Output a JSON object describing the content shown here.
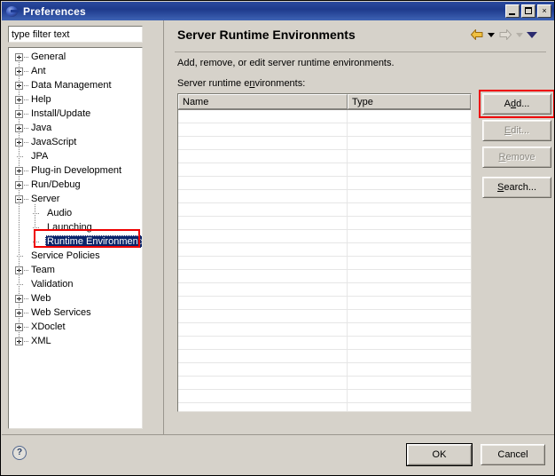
{
  "window": {
    "title": "Preferences",
    "icon": "eclipse-sphere-icon",
    "controls": {
      "minimize": "minimize-icon",
      "maximize": "maximize-icon",
      "close": "×"
    }
  },
  "sidebar": {
    "filter": {
      "value": "type filter text",
      "placeholder": "type filter text"
    },
    "tree": [
      {
        "label": "General",
        "depth": 0,
        "expander": "plus"
      },
      {
        "label": "Ant",
        "depth": 0,
        "expander": "plus"
      },
      {
        "label": "Data Management",
        "depth": 0,
        "expander": "plus"
      },
      {
        "label": "Help",
        "depth": 0,
        "expander": "plus"
      },
      {
        "label": "Install/Update",
        "depth": 0,
        "expander": "plus"
      },
      {
        "label": "Java",
        "depth": 0,
        "expander": "plus"
      },
      {
        "label": "JavaScript",
        "depth": 0,
        "expander": "plus"
      },
      {
        "label": "JPA",
        "depth": 0,
        "expander": "none"
      },
      {
        "label": "Plug-in Development",
        "depth": 0,
        "expander": "plus"
      },
      {
        "label": "Run/Debug",
        "depth": 0,
        "expander": "plus"
      },
      {
        "label": "Server",
        "depth": 0,
        "expander": "minus"
      },
      {
        "label": "Audio",
        "depth": 1,
        "expander": "none"
      },
      {
        "label": "Launching",
        "depth": 1,
        "expander": "none"
      },
      {
        "label": "Runtime Environments",
        "depth": 1,
        "expander": "none",
        "selected": true,
        "highlighted": true
      },
      {
        "label": "Service Policies",
        "depth": 0,
        "expander": "none"
      },
      {
        "label": "Team",
        "depth": 0,
        "expander": "plus"
      },
      {
        "label": "Validation",
        "depth": 0,
        "expander": "none"
      },
      {
        "label": "Web",
        "depth": 0,
        "expander": "plus"
      },
      {
        "label": "Web Services",
        "depth": 0,
        "expander": "plus"
      },
      {
        "label": "XDoclet",
        "depth": 0,
        "expander": "plus"
      },
      {
        "label": "XML",
        "depth": 0,
        "expander": "plus"
      }
    ]
  },
  "page": {
    "title": "Server Runtime Environments",
    "description": "Add, remove, or edit server runtime environments.",
    "table_label_before": "Server runtime e",
    "table_label_mnemonic": "n",
    "table_label_after": "vironments:",
    "nav": {
      "back_icon": "arrow-left-icon",
      "back_menu_icon": "chevron-down-icon",
      "forward_icon": "arrow-right-icon",
      "forward_menu_icon": "chevron-down-icon",
      "menu_icon": "chevron-down-icon"
    }
  },
  "table": {
    "columns": [
      "Name",
      "Type"
    ],
    "rows": [],
    "empty_row_count": 23
  },
  "side_buttons": [
    {
      "label_before": "A",
      "mnemonic": "d",
      "label_after": "d...",
      "name": "add-button",
      "enabled": true,
      "highlighted": true
    },
    {
      "label_before": "",
      "mnemonic": "E",
      "label_after": "dit...",
      "name": "edit-button",
      "enabled": false,
      "highlighted": false
    },
    {
      "label_before": "",
      "mnemonic": "R",
      "label_after": "emove",
      "name": "remove-button",
      "enabled": false,
      "highlighted": false
    },
    {
      "label_before": "",
      "mnemonic": "S",
      "label_after": "earch...",
      "name": "search-button",
      "enabled": true,
      "highlighted": false
    }
  ],
  "footer": {
    "help_icon": "?",
    "ok_label": "OK",
    "cancel_label": "Cancel"
  },
  "colors": {
    "titlebar": "#1f3c93",
    "dialog_bg": "#d6d2ca",
    "selection": "#0a246a",
    "highlight_red": "#ee0000",
    "arrow_enabled": "#e8a317",
    "arrow_disabled": "#cdcdc5"
  }
}
